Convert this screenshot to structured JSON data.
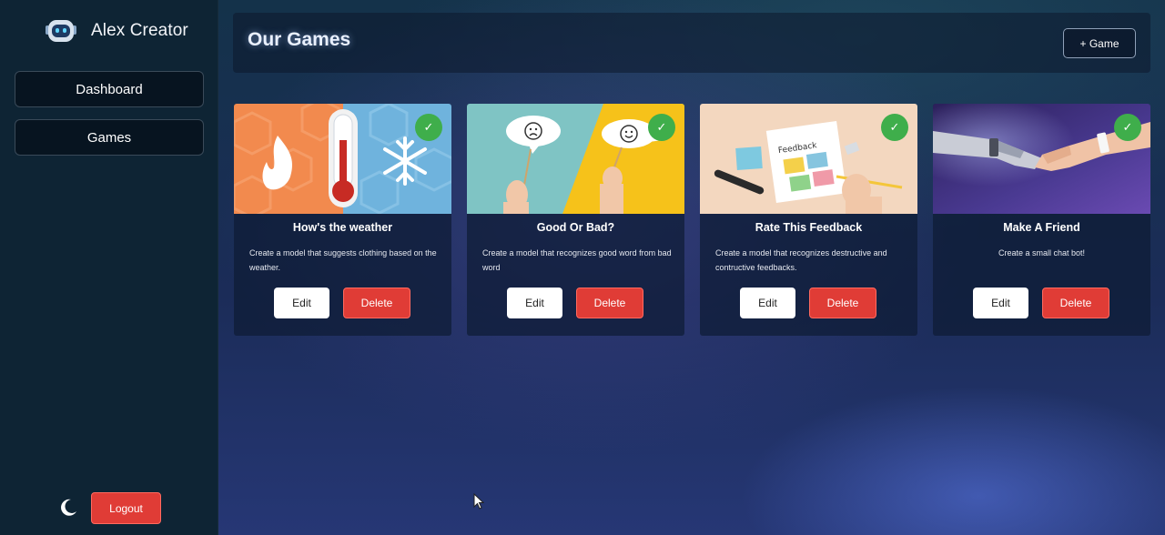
{
  "app": {
    "name": "Alex Creator"
  },
  "sidebar": {
    "items": [
      {
        "label": "Dashboard"
      },
      {
        "label": "Games"
      }
    ],
    "logout_label": "Logout"
  },
  "header": {
    "title": "Our Games",
    "add_button_label": "+ Game"
  },
  "games": [
    {
      "title": "How's the weather",
      "description": "Create a model that suggests clothing based on the weather.",
      "edit_label": "Edit",
      "delete_label": "Delete",
      "status_icon": "check-icon",
      "image": "weather-thermometer-image"
    },
    {
      "title": "Good Or Bad?",
      "description": "Create a model that recognizes good word from bad word",
      "edit_label": "Edit",
      "delete_label": "Delete",
      "status_icon": "check-icon",
      "image": "good-bad-signs-image"
    },
    {
      "title": "Rate This Feedback",
      "description": "Create a model that recognizes destructive and contructive feedbacks.",
      "edit_label": "Edit",
      "delete_label": "Delete",
      "status_icon": "check-icon",
      "image": "feedback-form-image"
    },
    {
      "title": "Make A Friend",
      "description": "Create a small chat bot!",
      "edit_label": "Edit",
      "delete_label": "Delete",
      "status_icon": "check-icon",
      "image": "robot-handshake-image"
    }
  ],
  "colors": {
    "sidebar_bg": "#0e2434",
    "delete": "#e03c36",
    "check": "#3fae4b"
  }
}
